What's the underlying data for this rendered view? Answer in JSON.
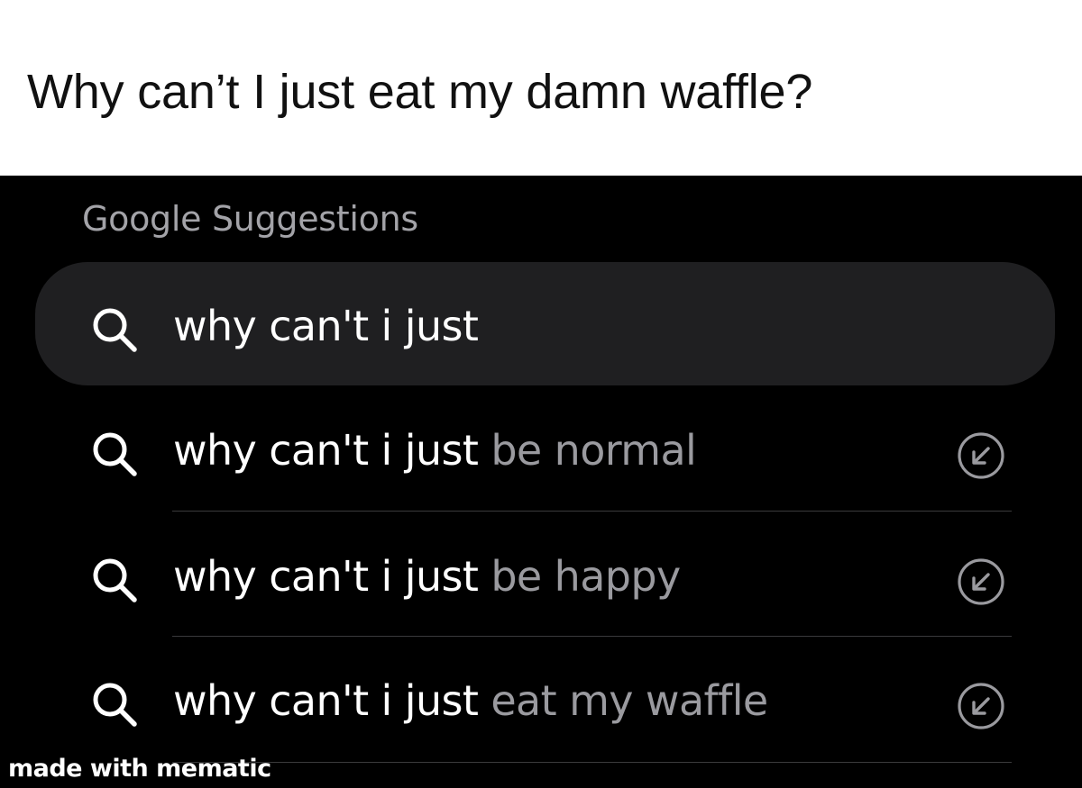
{
  "caption": {
    "text": "Why can’t I just eat my damn waffle?"
  },
  "suggestions_panel": {
    "title": "Google Suggestions",
    "search_field": {
      "typed_text": "why can't i just",
      "icon": "search-icon"
    },
    "suggestions": [
      {
        "typed_part": "why can't i just",
        "completion": " be normal",
        "icon": "search-icon",
        "action_icon": "fill-query-arrow-icon"
      },
      {
        "typed_part": "why can't i just",
        "completion": " be happy",
        "icon": "search-icon",
        "action_icon": "fill-query-arrow-icon"
      },
      {
        "typed_part": "why can't i just",
        "completion": " eat my waffle",
        "icon": "search-icon",
        "action_icon": "fill-query-arrow-icon"
      }
    ]
  },
  "watermark": {
    "text": "made with mematic"
  },
  "colors": {
    "caption_background": "#ffffff",
    "panel_background": "#000000",
    "search_field_background": "#1f1f21",
    "typed_text": "#ffffff",
    "completion_text": "#9a9a9f",
    "section_title": "#a3a3a8",
    "divider": "#3a3a3c"
  }
}
